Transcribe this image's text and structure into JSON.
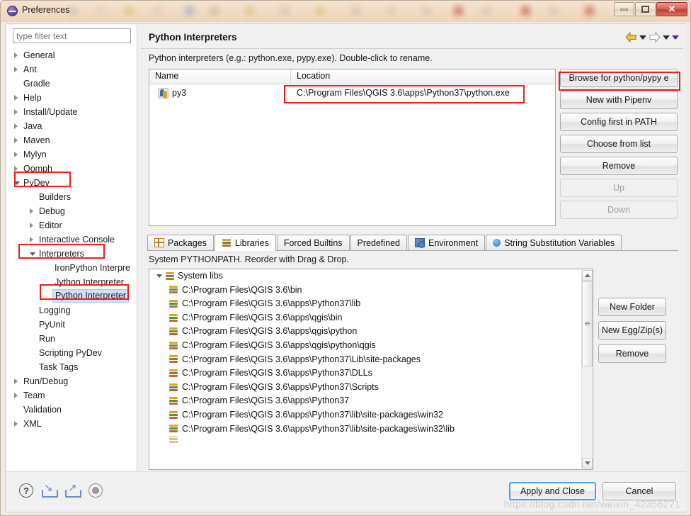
{
  "window": {
    "title": "Preferences",
    "icon": "eclipse-icon",
    "controls": {
      "minimize": "−",
      "maximize": "□",
      "close": "✕"
    }
  },
  "sidebar": {
    "filter_placeholder": "type filter text",
    "items": [
      {
        "label": "General",
        "indent": 0,
        "arrow": "collapsed"
      },
      {
        "label": "Ant",
        "indent": 0,
        "arrow": "collapsed"
      },
      {
        "label": "Gradle",
        "indent": 0,
        "arrow": "none"
      },
      {
        "label": "Help",
        "indent": 0,
        "arrow": "collapsed"
      },
      {
        "label": "Install/Update",
        "indent": 0,
        "arrow": "collapsed"
      },
      {
        "label": "Java",
        "indent": 0,
        "arrow": "collapsed"
      },
      {
        "label": "Maven",
        "indent": 0,
        "arrow": "collapsed"
      },
      {
        "label": "Mylyn",
        "indent": 0,
        "arrow": "collapsed"
      },
      {
        "label": "Oomph",
        "indent": 0,
        "arrow": "collapsed"
      },
      {
        "label": "PyDev",
        "indent": 0,
        "arrow": "expanded",
        "highlight": true
      },
      {
        "label": "Builders",
        "indent": 1,
        "arrow": "none"
      },
      {
        "label": "Debug",
        "indent": 1,
        "arrow": "collapsed"
      },
      {
        "label": "Editor",
        "indent": 1,
        "arrow": "collapsed"
      },
      {
        "label": "Interactive Console",
        "indent": 1,
        "arrow": "collapsed"
      },
      {
        "label": "Interpreters",
        "indent": 1,
        "arrow": "expanded",
        "highlight": true
      },
      {
        "label": "IronPython Interpre",
        "indent": 2,
        "arrow": "none"
      },
      {
        "label": "Jython Interpreter",
        "indent": 2,
        "arrow": "none"
      },
      {
        "label": "Python Interpreter",
        "indent": 2,
        "arrow": "none",
        "selected": true,
        "highlight": true
      },
      {
        "label": "Logging",
        "indent": 1,
        "arrow": "none"
      },
      {
        "label": "PyUnit",
        "indent": 1,
        "arrow": "none"
      },
      {
        "label": "Run",
        "indent": 1,
        "arrow": "none"
      },
      {
        "label": "Scripting PyDev",
        "indent": 1,
        "arrow": "none"
      },
      {
        "label": "Task Tags",
        "indent": 1,
        "arrow": "none"
      },
      {
        "label": "Run/Debug",
        "indent": 0,
        "arrow": "collapsed"
      },
      {
        "label": "Team",
        "indent": 0,
        "arrow": "collapsed"
      },
      {
        "label": "Validation",
        "indent": 0,
        "arrow": "none"
      },
      {
        "label": "XML",
        "indent": 0,
        "arrow": "collapsed"
      }
    ]
  },
  "main": {
    "title": "Python Interpreters",
    "description": "Python interpreters (e.g.: python.exe, pypy.exe).   Double-click to rename.",
    "table": {
      "columns": [
        "Name",
        "Location"
      ],
      "rows": [
        {
          "name": "py3",
          "location": "C:\\Program Files\\QGIS 3.6\\apps\\Python37\\python.exe"
        }
      ]
    },
    "buttons": [
      {
        "label": "Browse for python/pypy e",
        "enabled": true,
        "mnemonic": "e",
        "highlight": true
      },
      {
        "label": "New with Pipenv",
        "enabled": true,
        "mnemonic": "N"
      },
      {
        "label": "Config first in PATH",
        "enabled": true,
        "mnemonic": "f"
      },
      {
        "label": "Choose from list",
        "enabled": true,
        "mnemonic": "C"
      },
      {
        "label": "Remove",
        "enabled": true,
        "mnemonic": "R"
      },
      {
        "label": "Up",
        "enabled": false,
        "mnemonic": "U"
      },
      {
        "label": "Down",
        "enabled": false,
        "mnemonic": "n"
      }
    ],
    "tabs": [
      {
        "label": "Packages",
        "icon": "grid-icon",
        "active": false
      },
      {
        "label": "Libraries",
        "icon": "books-icon",
        "active": true
      },
      {
        "label": "Forced Builtins",
        "icon": "none",
        "active": false
      },
      {
        "label": "Predefined",
        "icon": "none",
        "active": false
      },
      {
        "label": "Environment",
        "icon": "environment-icon",
        "active": false
      },
      {
        "label": "String Substitution Variables",
        "icon": "sphere-icon",
        "active": false
      }
    ],
    "libraries": {
      "description": "System PYTHONPATH.   Reorder with Drag & Drop.",
      "root_label": "System libs",
      "paths": [
        "C:\\Program Files\\QGIS 3.6\\bin",
        "C:\\Program Files\\QGIS 3.6\\apps\\Python37\\lib",
        "C:\\Program Files\\QGIS 3.6\\apps\\qgis\\bin",
        "C:\\Program Files\\QGIS 3.6\\apps\\qgis\\python",
        "C:\\Program Files\\QGIS 3.6\\apps\\qgis\\python\\qgis",
        "C:\\Program Files\\QGIS 3.6\\apps\\Python37\\Lib\\site-packages",
        "C:\\Program Files\\QGIS 3.6\\apps\\Python37\\DLLs",
        "C:\\Program Files\\QGIS 3.6\\apps\\Python37\\Scripts",
        "C:\\Program Files\\QGIS 3.6\\apps\\Python37",
        "C:\\Program Files\\QGIS 3.6\\apps\\Python37\\lib\\site-packages\\win32",
        "C:\\Program Files\\QGIS 3.6\\apps\\Python37\\lib\\site-packages\\win32\\lib"
      ],
      "buttons": [
        {
          "label": "New Folder"
        },
        {
          "label": "New Egg/Zip(s)"
        },
        {
          "label": "Remove",
          "mnemonic": "R"
        }
      ]
    }
  },
  "footer": {
    "icons": [
      {
        "name": "help-icon",
        "glyph": "?"
      },
      {
        "name": "import-icon",
        "glyph": "↘"
      },
      {
        "name": "export-icon",
        "glyph": "↗"
      },
      {
        "name": "record-icon",
        "glyph": "●"
      }
    ],
    "apply_label": "Apply and Close",
    "cancel_label": "Cancel",
    "watermark": "https://blog.csdn.net/weixin_42356271"
  },
  "colors": {
    "annotation": "#f41c1c",
    "selection": "#cfe2f5",
    "primary_border": "#4aa8e0",
    "titlebar": "#f1dcc6"
  }
}
